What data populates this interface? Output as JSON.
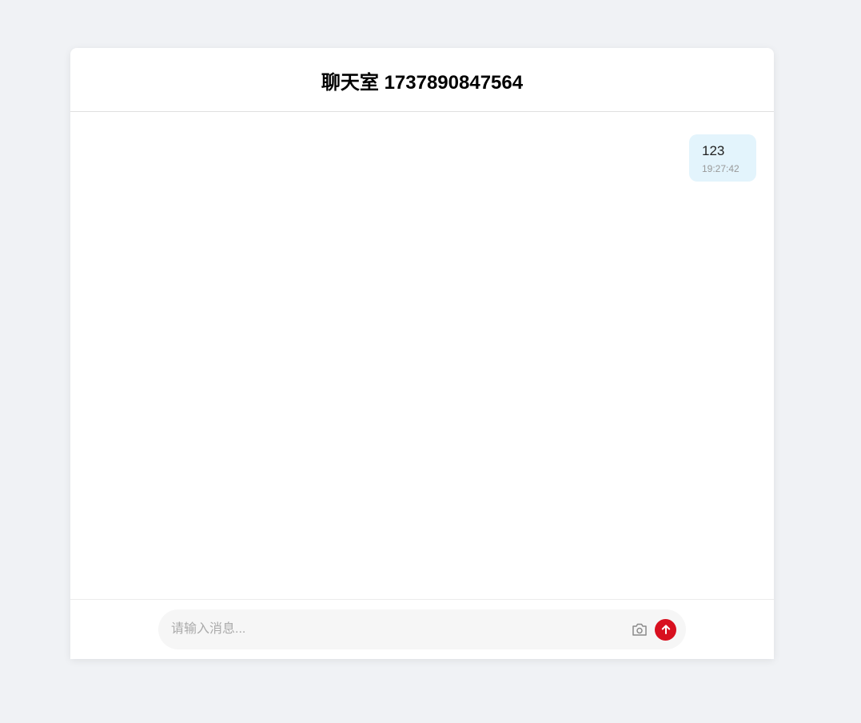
{
  "header": {
    "title": "聊天室 1737890847564"
  },
  "messages": [
    {
      "text": "123",
      "time": "19:27:42",
      "side": "right"
    }
  ],
  "composer": {
    "placeholder": "请输入消息...",
    "value": "",
    "camera_icon": "camera-icon",
    "send_icon": "arrow-up-icon",
    "send_color": "#d8101f"
  },
  "colors": {
    "background": "#f0f2f5",
    "bubble": "#e3f4fc",
    "accent": "#d8101f"
  }
}
